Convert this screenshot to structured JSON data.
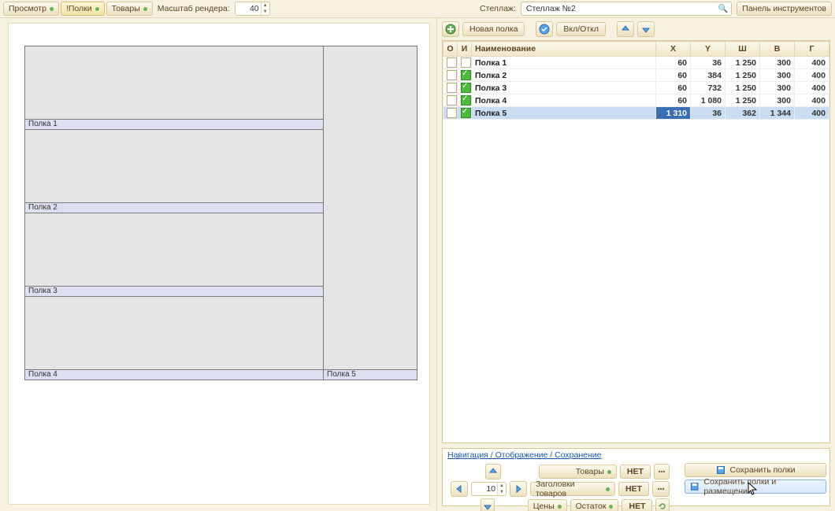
{
  "top": {
    "preview": "Просмотр",
    "shelves": "!Полки",
    "products": "Товары",
    "render_scale_label": "Масштаб рендера:",
    "render_scale_value": "40",
    "rack_label": "Стеллаж:",
    "rack_value": "Стеллаж №2",
    "tools_panel": "Панель инструментов"
  },
  "preview": {
    "shelf1": "Полка 1",
    "shelf2": "Полка 2",
    "shelf3": "Полка 3",
    "shelf4": "Полка 4",
    "shelf5": "Полка 5"
  },
  "right_toolbar": {
    "new_shelf": "Новая полка",
    "toggle": "Вкл/Откл"
  },
  "grid": {
    "headers": {
      "o": "О",
      "i": "И",
      "name": "Наименование",
      "x": "X",
      "y": "Y",
      "w": "Ш",
      "h": "В",
      "d": "Г"
    },
    "rows": [
      {
        "chk": false,
        "name": "Полка 1",
        "x": "60",
        "y": "36",
        "w": "1 250",
        "h": "300",
        "d": "400"
      },
      {
        "chk": true,
        "name": "Полка 2",
        "x": "60",
        "y": "384",
        "w": "1 250",
        "h": "300",
        "d": "400"
      },
      {
        "chk": true,
        "name": "Полка 3",
        "x": "60",
        "y": "732",
        "w": "1 250",
        "h": "300",
        "d": "400"
      },
      {
        "chk": true,
        "name": "Полка 4",
        "x": "60",
        "y": "1 080",
        "w": "1 250",
        "h": "300",
        "d": "400"
      },
      {
        "chk": true,
        "name": "Полка 5",
        "x": "1 310",
        "y": "36",
        "w": "362",
        "h": "1 344",
        "d": "400",
        "sel": true
      }
    ]
  },
  "bottom": {
    "breadcrumb": "Навигация / Отображение / Сохранение",
    "nav_value": "10",
    "products": "Товары",
    "product_headers": "Заголовки товаров",
    "prices": "Цены",
    "stock": "Остаток",
    "net": "НЕТ",
    "save_shelves": "Сохранить полки",
    "save_shelves_and_placement": "Сохранить полки и размещение"
  }
}
